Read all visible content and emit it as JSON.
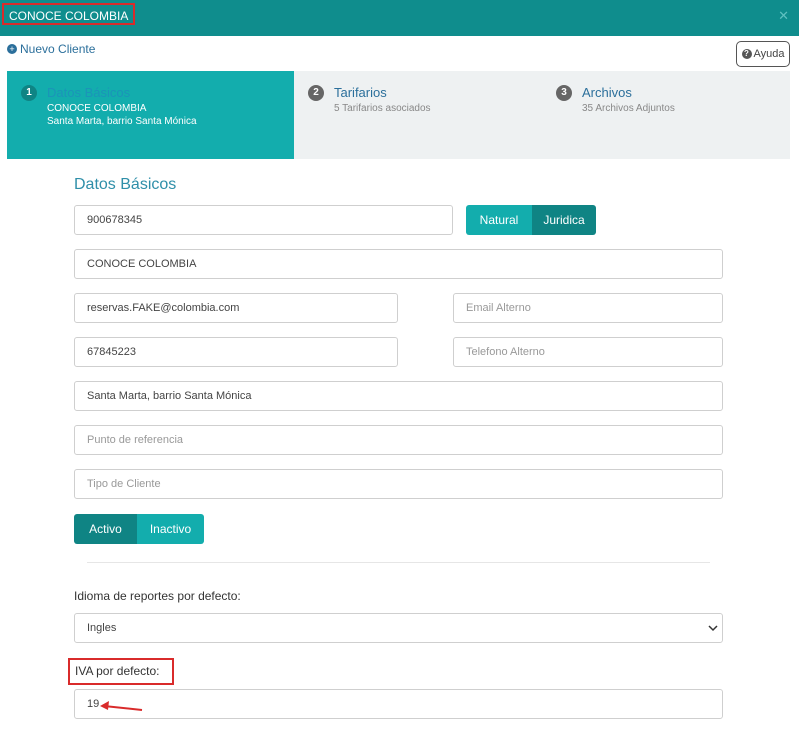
{
  "window": {
    "title": "CONOCE COLOMBIA"
  },
  "toolbar": {
    "new_client_label": "Nuevo Cliente",
    "help_label": "Ayuda"
  },
  "steps": [
    {
      "number": "1",
      "title": "Datos Básicos",
      "line1": "CONOCE COLOMBIA",
      "line2": "Santa Marta, barrio Santa Mónica",
      "active": true
    },
    {
      "number": "2",
      "title": "Tarifarios",
      "line1": "5 Tarifarios asociados",
      "active": false
    },
    {
      "number": "3",
      "title": "Archivos",
      "line1": "35 Archivos Adjuntos",
      "active": false
    }
  ],
  "form": {
    "section_title": "Datos Básicos",
    "id_number": "900678345",
    "person_type": {
      "options": [
        "Natural",
        "Juridica"
      ],
      "selected": "Juridica"
    },
    "name": "CONOCE COLOMBIA",
    "email": "reservas.FAKE@colombia.com",
    "email_alt_placeholder": "Email Alterno",
    "phone": "67845223",
    "phone_alt_placeholder": "Telefono Alterno",
    "address": "Santa Marta, barrio Santa Mónica",
    "reference_placeholder": "Punto de referencia",
    "client_type_placeholder": "Tipo de Cliente",
    "status": {
      "options": [
        "Activo",
        "Inactivo"
      ],
      "selected": "Activo"
    },
    "report_language_label": "Idioma de reportes por defecto:",
    "report_language_value": "Ingles",
    "iva_label": "IVA por defecto:",
    "iva_value": "19"
  },
  "colors": {
    "header": "#0f8d8d",
    "accent": "#13adad",
    "accent_dark": "#0f8484",
    "highlight_border": "#d92b2b",
    "link": "#2b6f9b"
  }
}
